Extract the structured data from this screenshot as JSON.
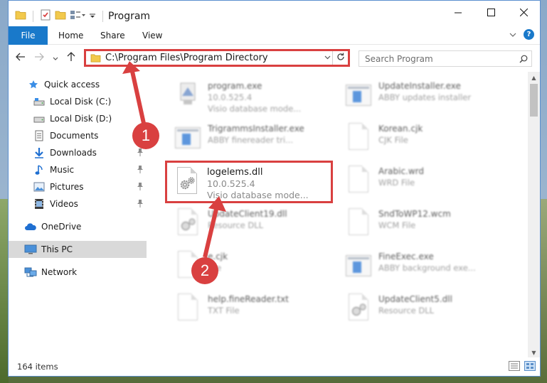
{
  "window": {
    "title": "Program",
    "controls": {
      "minimize": "minimize-icon",
      "maximize": "maximize-icon",
      "close": "close-icon"
    }
  },
  "ribbon": {
    "tabs": [
      {
        "label": "File",
        "active": true
      },
      {
        "label": "Home"
      },
      {
        "label": "Share"
      },
      {
        "label": "View"
      }
    ],
    "help_label": "?"
  },
  "navigation": {
    "address_path": "C:\\Program Files\\Program Directory",
    "search_placeholder": "Search Program"
  },
  "sidebar": {
    "items": [
      {
        "label": "Quick access",
        "icon": "star-icon"
      },
      {
        "label": "Local Disk (C:)",
        "icon": "drive-icon"
      },
      {
        "label": "Local Disk (D:)",
        "icon": "drive-icon"
      },
      {
        "label": "Documents",
        "icon": "documents-icon"
      },
      {
        "label": "Downloads",
        "icon": "downloads-icon",
        "pinned": true
      },
      {
        "label": "Music",
        "icon": "music-icon",
        "pinned": true
      },
      {
        "label": "Pictures",
        "icon": "pictures-icon",
        "pinned": true
      },
      {
        "label": "Videos",
        "icon": "videos-icon",
        "pinned": true
      },
      {
        "label": "OneDrive",
        "icon": "cloud-icon"
      },
      {
        "label": "This PC",
        "icon": "computer-icon",
        "selected": true
      },
      {
        "label": "Network",
        "icon": "network-icon"
      }
    ]
  },
  "files": [
    {
      "name": "program.exe",
      "line2": "10.0.525.4",
      "line3": "Visio database mode...",
      "icon": "exe-icon"
    },
    {
      "name": "UpdateInstaller.exe",
      "line2": "ABBY updates installer",
      "line3": "",
      "icon": "app-icon"
    },
    {
      "name": "TrigrammsInstaller.exe",
      "line2": "ABBY finereader tri...",
      "line3": "",
      "icon": "app-icon"
    },
    {
      "name": "Korean.cjk",
      "line2": "CJK File",
      "line3": "",
      "icon": "document-icon"
    },
    {
      "name": "logelems.dll",
      "line2": "10.0.525.4",
      "line3": "Visio database mode...",
      "icon": "dll-gear-icon",
      "highlighted": true
    },
    {
      "name": "Arabic.wrd",
      "line2": "WRD File",
      "line3": "",
      "icon": "document-icon"
    },
    {
      "name": "UpdateClient19.dll",
      "line2": "Resource DLL",
      "line3": "",
      "icon": "dll-gear-icon"
    },
    {
      "name": "SndToWP12.wcm",
      "line2": "WCM File",
      "line3": "",
      "icon": "document-icon"
    },
    {
      "name": "e.cjk",
      "line2": "File",
      "line3": "",
      "icon": "document-icon"
    },
    {
      "name": "FineExec.exe",
      "line2": "ABBY background exe...",
      "line3": "",
      "icon": "app-icon"
    },
    {
      "name": "help.fineReader.txt",
      "line2": "TXT File",
      "line3": "",
      "icon": "document-icon"
    },
    {
      "name": "UpdateClient5.dll",
      "line2": "Resource DLL",
      "line3": "",
      "icon": "dll-gear-icon"
    }
  ],
  "status": {
    "item_count": "164 items"
  },
  "annotations": {
    "step1": "1",
    "step2": "2",
    "color": "#d94040"
  },
  "colors": {
    "accent": "#1979ca",
    "highlight_border": "#d94040",
    "selected_bg": "#d9d9d9"
  }
}
